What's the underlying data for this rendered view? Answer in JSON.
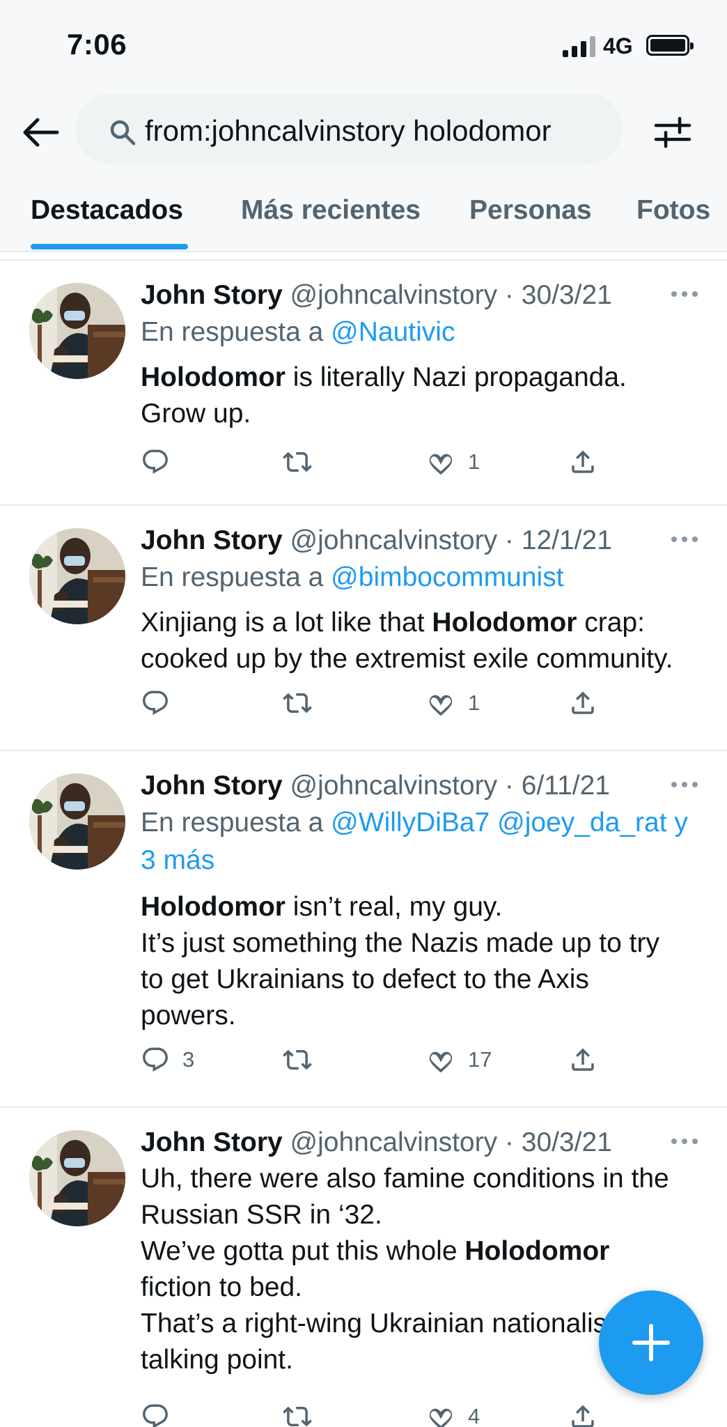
{
  "status_bar": {
    "time": "7:06",
    "network": "4G"
  },
  "search": {
    "query": "from:johncalvinstory holodomor"
  },
  "tabs": [
    {
      "label": "Destacados"
    },
    {
      "label": "Más recientes"
    },
    {
      "label": "Personas"
    },
    {
      "label": "Fotos"
    }
  ],
  "tweets": [
    {
      "name": "John Story",
      "handle": "@johncalvinstory",
      "sep": "·",
      "date": "30/3/21",
      "reply_prefix": "En respuesta a ",
      "reply_to": "@Nautivic",
      "text_a": "Holodomor",
      "text_b": " is literally Nazi propaganda.",
      "text_c": "Grow up.",
      "reply_count": "",
      "retweet_count": "",
      "like_count": "1"
    },
    {
      "name": "John Story",
      "handle": "@johncalvinstory",
      "sep": "·",
      "date": "12/1/21",
      "reply_prefix": "En respuesta a ",
      "reply_to": "@bimbocommunist",
      "text_a": "Xinjiang is a lot like that ",
      "text_b": "Holodomor",
      "text_c": " crap:",
      "text_d": "cooked up by the extremist exile community.",
      "reply_count": "",
      "retweet_count": "",
      "like_count": "1"
    },
    {
      "name": "John Story",
      "handle": "@johncalvinstory",
      "sep": "·",
      "date": "6/11/21",
      "reply_prefix": "En respuesta a ",
      "reply_to": "@WillyDiBa7 @joey_da_rat y",
      "reply_more": "3 más",
      "text_a": "Holodomor",
      "text_b": " isn’t real, my guy.",
      "text_c": "It’s just something the Nazis made up to try",
      "text_d": "to get Ukrainians to defect to the Axis",
      "text_e": "powers.",
      "reply_count": "3",
      "retweet_count": "",
      "like_count": "17"
    },
    {
      "name": "John Story",
      "handle": "@johncalvinstory",
      "sep": "·",
      "date": "30/3/21",
      "text_a": "Uh, there were also famine conditions in the",
      "text_b": "Russian SSR in ‘32.",
      "text_c": "We’ve gotta put this whole ",
      "text_d": "Holodomor",
      "text_e": "fiction to bed.",
      "text_f": "That’s a right-wing Ukrainian nationalist",
      "text_g": "talking point.",
      "reply_count": "",
      "retweet_count": "",
      "like_count": "4"
    }
  ],
  "icons": {
    "back": "arrow-left-icon",
    "search": "search-icon",
    "filter": "filter-sliders-icon",
    "reply": "reply-icon",
    "retweet": "retweet-icon",
    "like": "heart-icon",
    "share": "share-icon",
    "more": "more-dots-icon",
    "compose": "plus-icon"
  },
  "colors": {
    "accent": "#1d9bf0",
    "text": "#0f1419",
    "muted": "#536471",
    "divider": "#e6e9eb"
  }
}
